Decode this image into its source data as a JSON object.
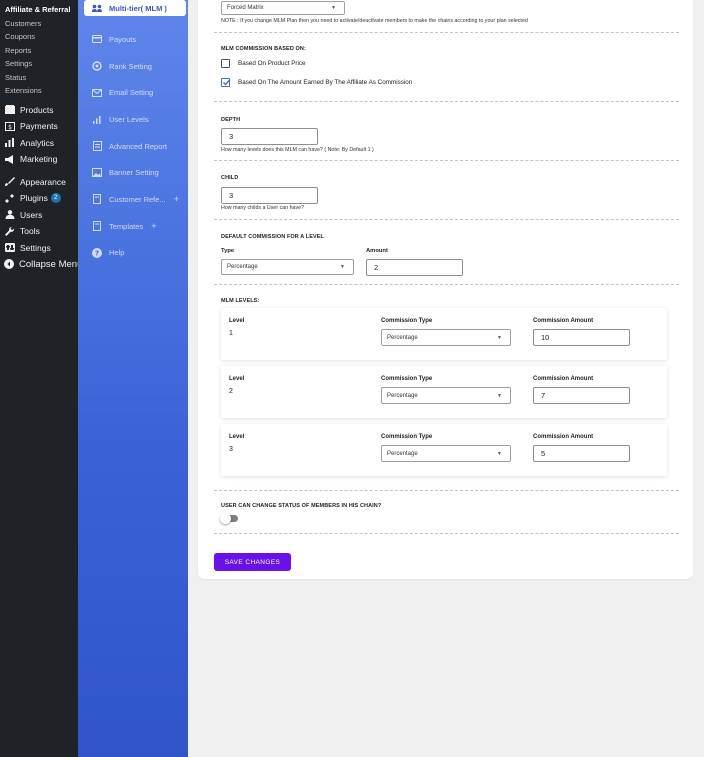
{
  "wp_sidebar": {
    "sub_items": [
      "Affiliate & Referral",
      "Customers",
      "Coupons",
      "Reports",
      "Settings",
      "Status",
      "Extensions"
    ],
    "menu": [
      {
        "label": "Products",
        "icon": "products-icon"
      },
      {
        "label": "Payments",
        "icon": "payments-icon"
      },
      {
        "label": "Analytics",
        "icon": "analytics-icon"
      },
      {
        "label": "Marketing",
        "icon": "marketing-icon"
      },
      {
        "label": "Appearance",
        "icon": "appearance-icon"
      },
      {
        "label": "Plugins",
        "icon": "plugins-icon",
        "badge": "2"
      },
      {
        "label": "Users",
        "icon": "users-icon"
      },
      {
        "label": "Tools",
        "icon": "tools-icon"
      },
      {
        "label": "Settings",
        "icon": "settings-icon"
      }
    ],
    "collapse_label": "Collapse Menu"
  },
  "plugin_nav": {
    "items": [
      {
        "label": "Multi-tier( MLM )",
        "icon": "network-icon"
      },
      {
        "label": "Payouts",
        "icon": "payouts-icon"
      },
      {
        "label": "Rank Setting",
        "icon": "rank-icon"
      },
      {
        "label": "Email Setting",
        "icon": "email-icon"
      },
      {
        "label": "User Levels",
        "icon": "levels-icon"
      },
      {
        "label": "Advanced Report",
        "icon": "report-icon"
      },
      {
        "label": "Banner Setting",
        "icon": "banner-icon"
      },
      {
        "label": "Customer Refe...",
        "icon": "customer-icon",
        "plus": "+"
      },
      {
        "label": "Templates",
        "icon": "templates-icon",
        "plus": "+"
      },
      {
        "label": "Help",
        "icon": "help-icon"
      }
    ]
  },
  "plan": {
    "selected": "Forced Matrix",
    "note": "NOTE : If you change MLM Plan then you need to activate/deactivate members to make the chains according to your plan selected"
  },
  "commission_based": {
    "title": "MLM COMMISSION BASED ON:",
    "options": [
      {
        "label": "Based On Product Price",
        "checked": false
      },
      {
        "label": "Based On The Amount Earned By The Affiliate As Commission",
        "checked": true
      }
    ]
  },
  "depth": {
    "title": "DEPTH",
    "value": "3",
    "help": "How many levels does this MLM can have? ( Note: By Default 1 )"
  },
  "child": {
    "title": "CHILD",
    "value": "3",
    "help": "How many childs a User can have?"
  },
  "default_commission": {
    "title": "DEFAULT COMMISSION FOR A LEVEL",
    "type_label": "Type",
    "type_value": "Percentage",
    "amount_label": "Amount",
    "amount_value": "2"
  },
  "mlm_levels": {
    "title": "MLM LEVELS:",
    "col_level": "Level",
    "col_type": "Commission Type",
    "col_amount": "Commission Amount",
    "rows": [
      {
        "level": "1",
        "type": "Percentage",
        "amount": "10"
      },
      {
        "level": "2",
        "type": "Percentage",
        "amount": "7"
      },
      {
        "level": "3",
        "type": "Percentage",
        "amount": "5"
      }
    ]
  },
  "user_status": {
    "title": "USER CAN CHANGE STATUS OF MEMBERS IN HIS CHAIN?",
    "enabled": false
  },
  "save_label": "SAVE CHANGES",
  "colors": {
    "sidebar_bg": "#1d2327",
    "plugin_nav": "#3a62d6",
    "save_button": "#6a11e8",
    "checkbox_accent": "#3b6fe0"
  }
}
